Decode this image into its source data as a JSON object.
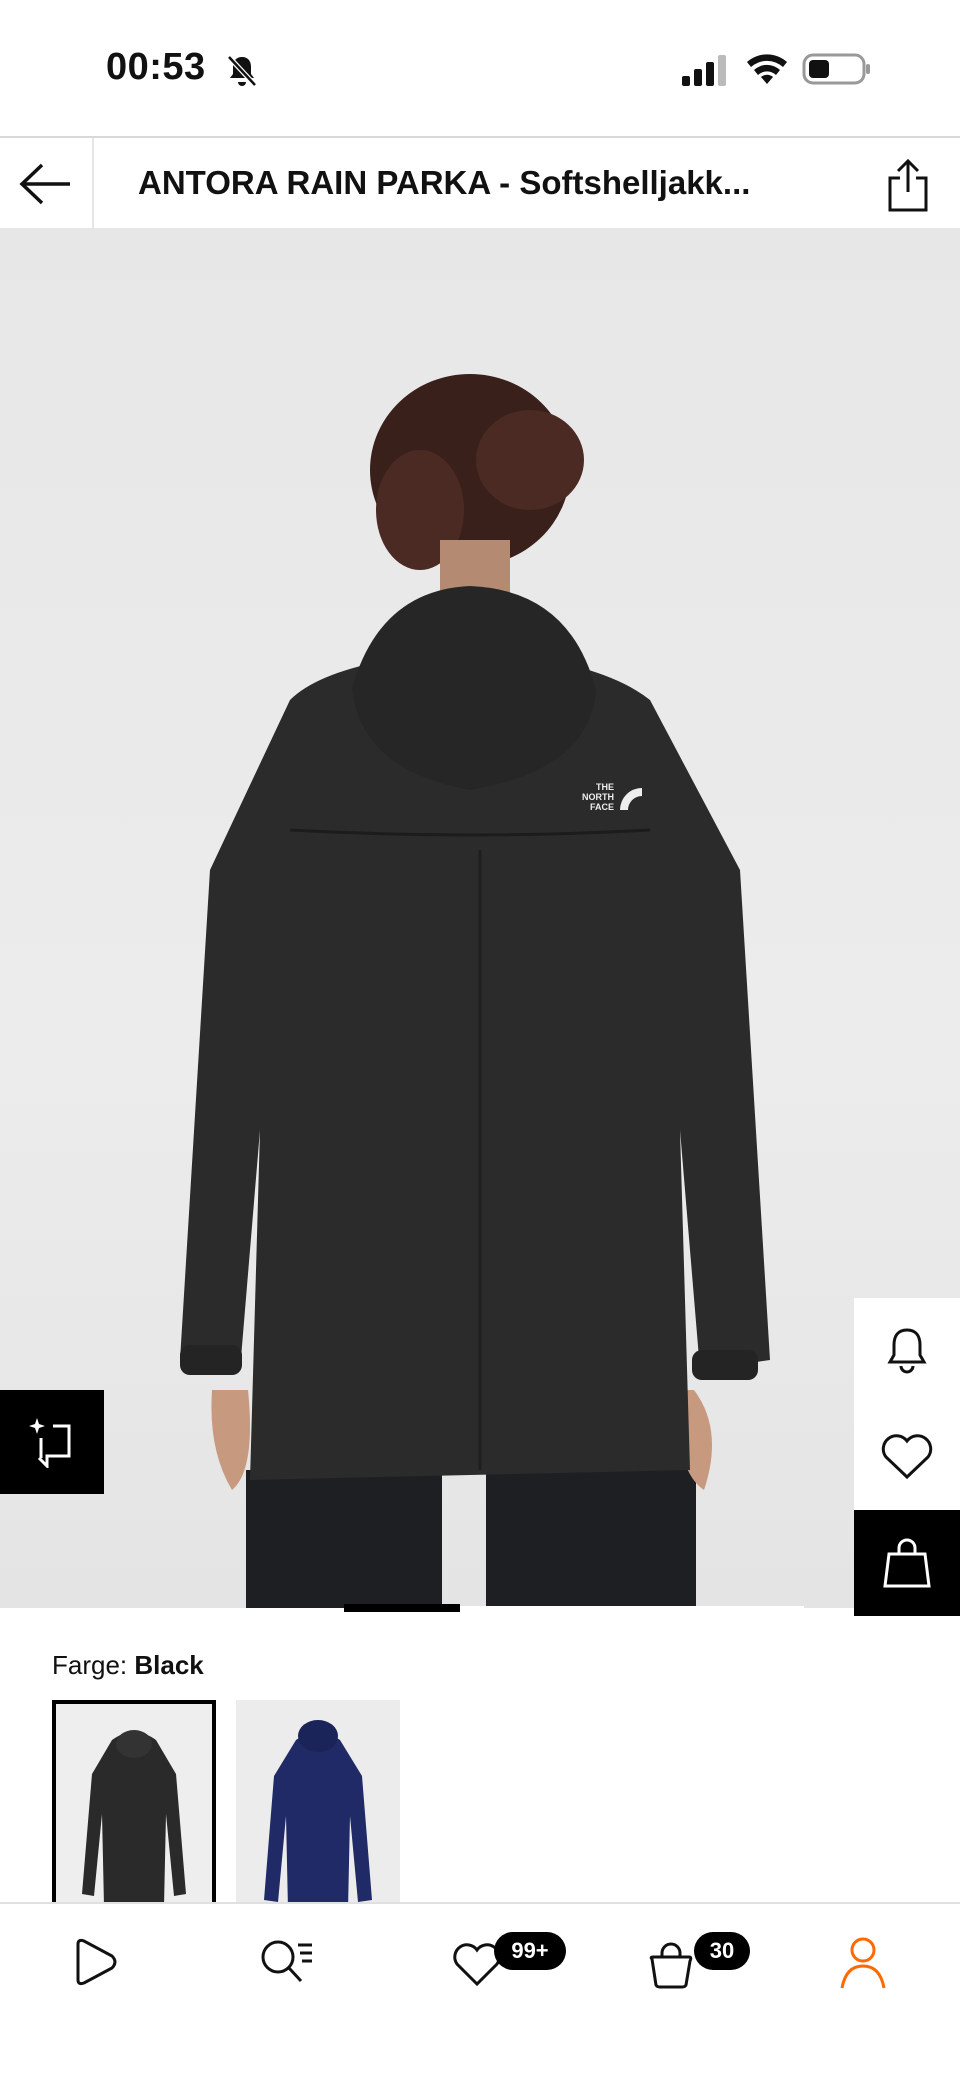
{
  "status_bar": {
    "time": "00:53",
    "icons": [
      "bell-off-icon",
      "cellular-signal-icon",
      "wifi-icon",
      "battery-icon"
    ]
  },
  "header": {
    "title": "ANTORA RAIN PARKA - Softshelljakk...",
    "back_icon": "arrow-left-icon",
    "share_icon": "share-icon"
  },
  "product_image": {
    "brand_logo_text": "THE NORTH FACE",
    "image_index": 1
  },
  "side_actions": {
    "items": [
      "bell-icon",
      "heart-icon",
      "shopping-bag-icon"
    ]
  },
  "color_section": {
    "label": "Farge:",
    "value": "Black",
    "swatches": [
      {
        "name": "Black",
        "selected": true
      },
      {
        "name": "Navy",
        "selected": false
      }
    ]
  },
  "bottom_nav": {
    "items": [
      {
        "icon": "play-icon"
      },
      {
        "icon": "search-list-icon"
      },
      {
        "icon": "heart-icon",
        "badge": "99+"
      },
      {
        "icon": "shopping-bag-icon",
        "badge": "30"
      },
      {
        "icon": "person-icon"
      }
    ]
  },
  "colors": {
    "accent": "#ff6900",
    "jacket": "#2b2b2b",
    "navy_jacket": "#1f2a66",
    "background": "#ebebeb"
  }
}
